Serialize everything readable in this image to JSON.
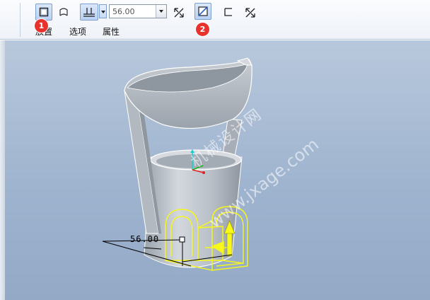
{
  "toolbar": {
    "depth_value": "56.00",
    "tabs": [
      "放置",
      "选项",
      "属性"
    ]
  },
  "annotations": {
    "badge_1": "1",
    "badge_2": "2"
  },
  "watermark": {
    "site_name": "机械设计网",
    "url": "www.jxage.com"
  },
  "dimension": {
    "value": "56.00"
  },
  "colors": {
    "viewport_top": "#b8c8dc",
    "viewport_bottom": "#93a9c6",
    "model_surface": "#c3c9d0",
    "selection_highlight": "#ffff33",
    "badge": "#e8322c"
  },
  "icons": [
    "solid-icon",
    "surface-icon",
    "depth-blind-icon",
    "flip-direction-icon",
    "remove-material-icon",
    "thicken-icon",
    "flip-thicken-icon"
  ]
}
